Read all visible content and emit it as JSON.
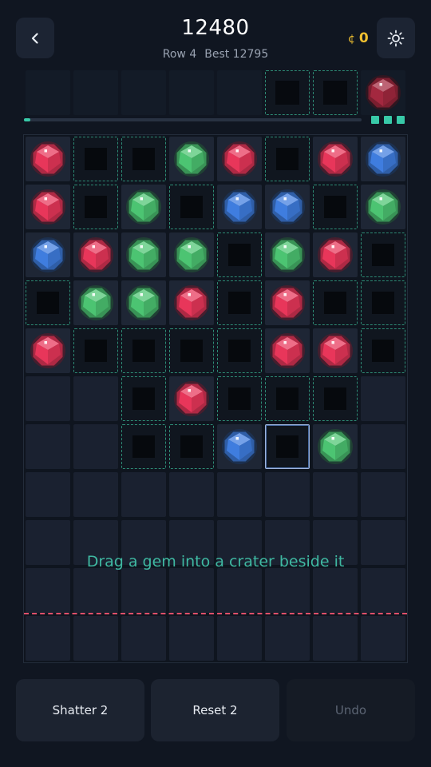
{
  "header": {
    "score": "12480",
    "row_label": "Row 4",
    "best_label": "Best 12795",
    "coins_symbol": "¢",
    "coins_value": "0",
    "back_icon": "chevron-left-icon",
    "settings_icon": "sun-icon"
  },
  "queue": {
    "cells": [
      "empty",
      "empty",
      "empty",
      "empty",
      "empty",
      "crater",
      "crater",
      "gem:red-dim"
    ],
    "progress": 0.02,
    "remaining_indicators": 3
  },
  "board": {
    "columns": 8,
    "rows": 11,
    "grid": [
      [
        "red",
        "crater",
        "crater",
        "green",
        "red",
        "crater",
        "red",
        "blue"
      ],
      [
        "red",
        "crater",
        "green",
        "crater",
        "blue",
        "blue",
        "crater",
        "green"
      ],
      [
        "blue",
        "red",
        "green",
        "green",
        "crater",
        "green",
        "red",
        "crater"
      ],
      [
        "crater",
        "green",
        "green",
        "red",
        "crater",
        "red",
        "crater",
        "crater"
      ],
      [
        "red",
        "crater",
        "crater",
        "crater",
        "crater",
        "red",
        "red",
        "crater"
      ],
      [
        "empty",
        "empty",
        "crater",
        "red",
        "crater",
        "crater",
        "crater",
        "empty"
      ],
      [
        "empty",
        "empty",
        "crater",
        "crater",
        "blue",
        "crater-selected",
        "green",
        "empty"
      ],
      [
        "empty",
        "empty",
        "empty",
        "empty",
        "empty",
        "empty",
        "empty",
        "empty"
      ],
      [
        "empty",
        "empty",
        "empty",
        "empty",
        "empty",
        "empty",
        "empty",
        "empty"
      ],
      [
        "empty",
        "empty",
        "empty",
        "empty",
        "empty",
        "empty",
        "empty",
        "empty"
      ],
      [
        "empty",
        "empty",
        "empty",
        "empty",
        "empty",
        "empty",
        "empty",
        "empty"
      ]
    ],
    "hint": "Drag a gem into a crater beside it"
  },
  "gem_colors": {
    "red": "#e8365a",
    "green": "#4cc472",
    "blue": "#3f7ddf",
    "red-dim": "#a3283f"
  },
  "actions": {
    "shatter": "Shatter 2",
    "reset": "Reset 2",
    "undo": "Undo"
  }
}
